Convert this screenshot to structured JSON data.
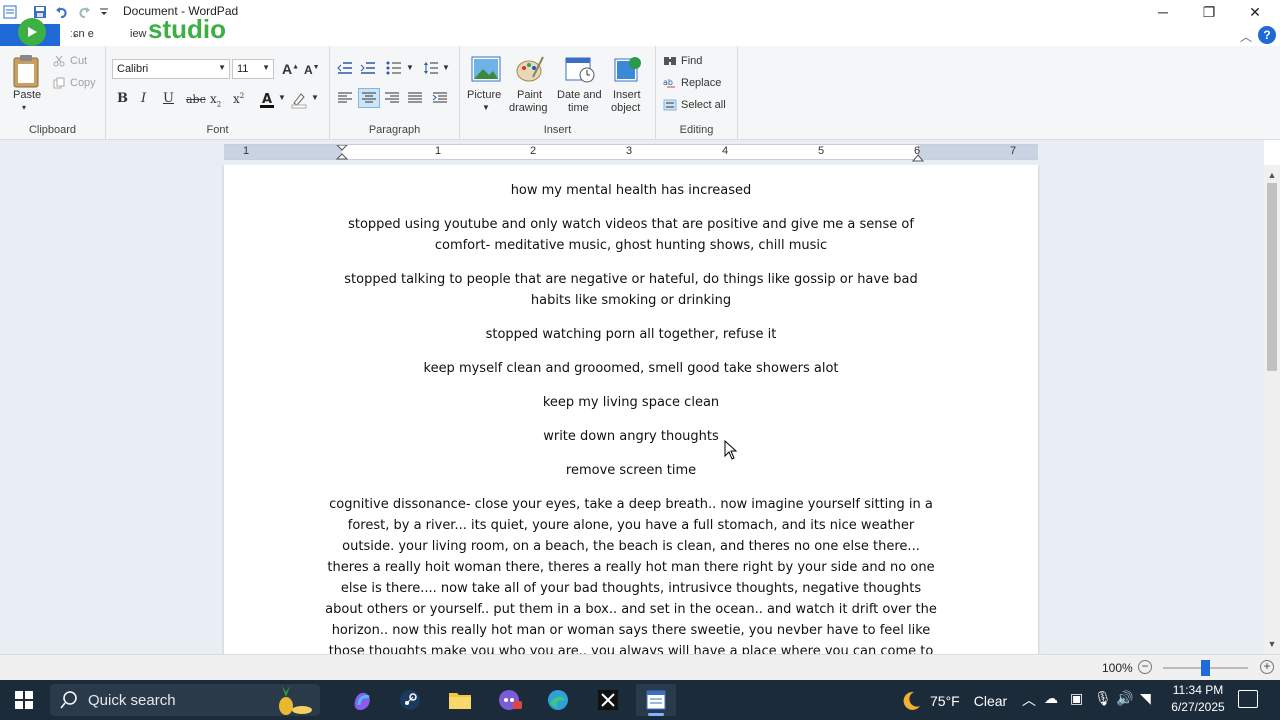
{
  "window": {
    "title": "Document - WordPad",
    "minimize": "─",
    "restore": "❐",
    "close": "✕"
  },
  "overlay": {
    "studio_text": "studio"
  },
  "tabs": {
    "home": "ːɕn e",
    "view": "iew"
  },
  "ribbon": {
    "clipboard": {
      "label": "Clipboard",
      "paste": "Paste",
      "cut": "Cut",
      "copy": "Copy"
    },
    "font": {
      "label": "Font",
      "family": "Calibri",
      "size": "11"
    },
    "paragraph": {
      "label": "Paragraph"
    },
    "insert": {
      "label": "Insert",
      "picture": "Picture",
      "paint_1": "Paint",
      "paint_2": "drawing",
      "date_1": "Date and",
      "date_2": "time",
      "object_1": "Insert",
      "object_2": "object"
    },
    "editing": {
      "label": "Editing",
      "find": "Find",
      "replace": "Replace",
      "select_all": "Select all"
    }
  },
  "ruler": {
    "numbers": [
      "1",
      "1",
      "2",
      "3",
      "4",
      "5",
      "6",
      "7"
    ]
  },
  "document": {
    "paragraphs": [
      {
        "lines": [
          "how my mental health has increased"
        ]
      },
      {
        "lines": [
          "stopped using youtube and only watch videos that are positive and give me a sense of",
          "comfort- meditative music, ghost hunting shows, chill music"
        ]
      },
      {
        "lines": [
          "stopped talking to people that are negative or hateful, do things like gossip or have bad",
          "habits like smoking or drinking"
        ]
      },
      {
        "lines": [
          "stopped watching porn all together, refuse it"
        ]
      },
      {
        "lines": [
          "keep myself clean and grooomed, smell good take showers alot"
        ]
      },
      {
        "lines": [
          "keep my living space clean"
        ]
      },
      {
        "lines": [
          "write down angry thoughts"
        ]
      },
      {
        "lines": [
          "remove screen time"
        ]
      },
      {
        "lines": [
          "cognitive dissonance- close your eyes, take a deep breath.. now imagine yourself sitting in a",
          "forest, by a river... its quiet, youre alone, you have a full stomach, and its nice weather",
          "outside. your living room, on a beach, the beach is clean, and theres no one else there...",
          "theres a really hoit woman there, theres a really hot man there right by your side and no one",
          "else is there.... now take all of your bad thoughts, intrusivce thoughts, negative thoughts",
          "about others or yourself.. put them in a box.. and set in the ocean.. and watch it drift over the",
          "horizon.. now this really hot man or woman says there sweetie, you nevber have to feel like",
          "those thoughts make you who you are.. you always will have a place where you can come to"
        ]
      }
    ]
  },
  "status": {
    "zoom": "100%"
  },
  "taskbar": {
    "search_placeholder": "Quick search",
    "weather_temp": "75°F",
    "weather_desc": "Clear",
    "time": "11:34 PM",
    "date": "6/27/2025"
  },
  "colors": {
    "accent": "#1f6ad6",
    "studio": "#3cb043",
    "taskbar": "#1c2b3a",
    "page_bg": "#e9eef5"
  }
}
